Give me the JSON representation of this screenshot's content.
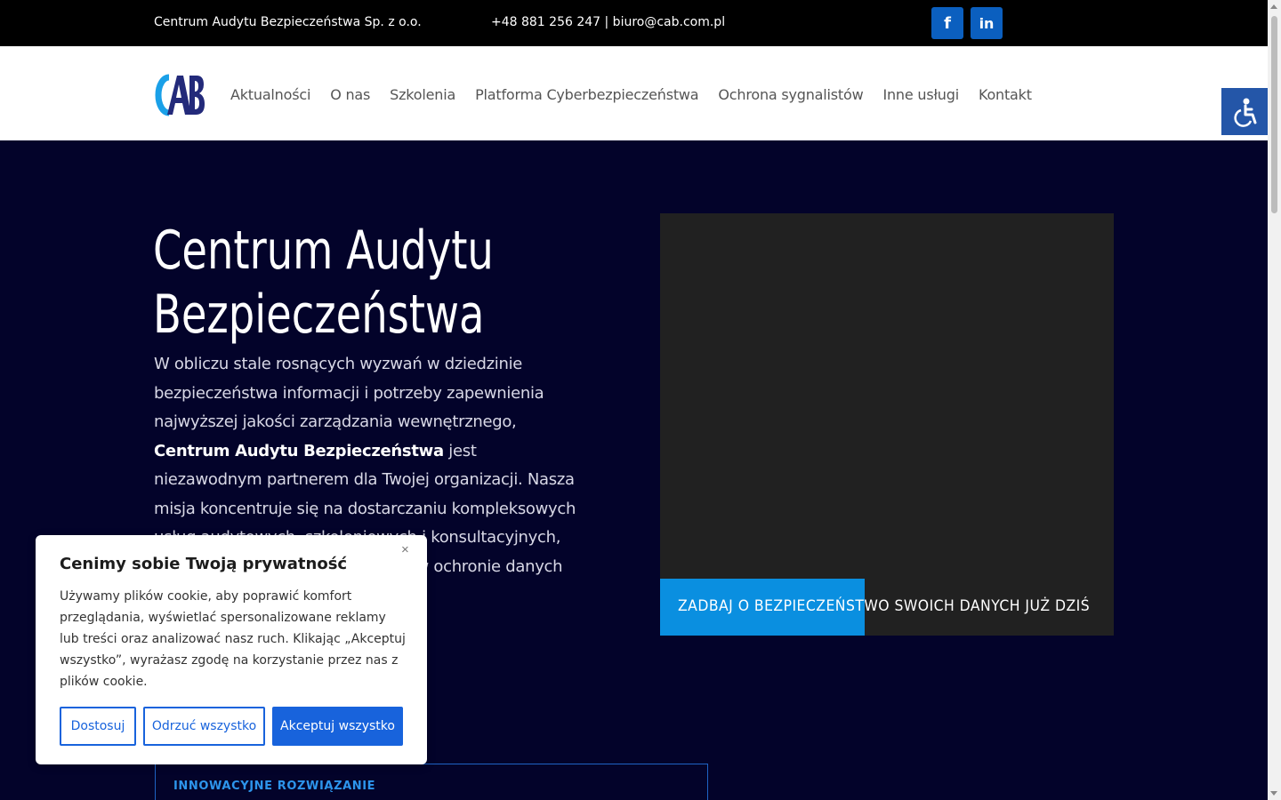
{
  "topbar": {
    "company": "Centrum Audytu Bezpieczeństwa Sp. z o.o.",
    "contact": "+48 881 256 247 | biuro@cab.com.pl",
    "facebook_icon": "f",
    "linkedin_icon": "in"
  },
  "header": {
    "logo_text": "CAB",
    "nav": [
      "Aktualności",
      "O nas",
      "Szkolenia",
      "Platforma Cyberbezpieczeństwa",
      "Ochrona sygnalistów",
      "Inne usługi",
      "Kontakt"
    ]
  },
  "hero": {
    "title_line1": "Centrum Audytu",
    "title_line2": "Bezpieczeństwa",
    "text_before": "W obliczu stale rosnących wyzwań w dziedzinie bezpieczeństwa informacji i potrzeby zapewnienia najwyższej jakości zarządzania wewnętrznego, ",
    "text_bold": "Centrum Audytu Bezpieczeństwa",
    "text_after": " jest niezawodnym partnerem dla Twojej organizacji. Nasza misja koncentruje się na dostarczaniu kompleksowych usług audytowych, szkoleniowych i konsultacyjnych, które wspierają naszych klientów w ochronie danych oraz",
    "video_caption": "ZADBAJ O BEZPIECZEŃSTWO SWOICH DANYCH JUŻ DZIŚ",
    "video_progress": 0.45,
    "innovation_label": "INNOWACYJNE ROZWIĄZANIE"
  },
  "cookie": {
    "title": "Cenimy sobie Twoją prywatność",
    "text": "Używamy plików cookie, aby poprawić komfort przeglądania, wyświetlać spersonalizowane reklamy lub treści oraz analizować nasz ruch. Klikając „Akceptuj wszystko”, wyrażasz zgodę na korzystanie przez nas z plików cookie.",
    "customize": "Dostosuj",
    "reject": "Odrzuć wszystko",
    "accept": "Akceptuj wszystko",
    "close": "×"
  },
  "colors": {
    "hero_bg": "#03032a",
    "accent_blue": "#0a8fe0",
    "button_blue": "#1863dc"
  }
}
